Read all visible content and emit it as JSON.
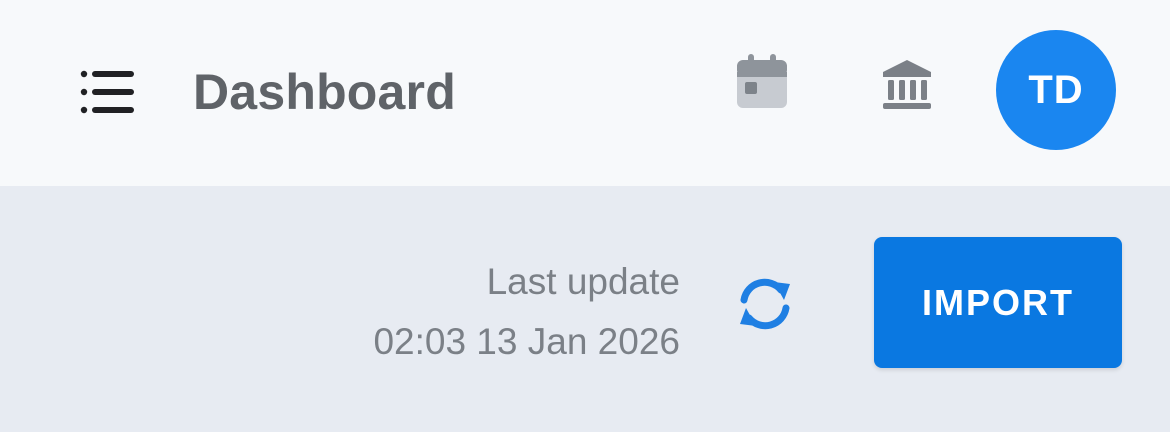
{
  "header": {
    "title": "Dashboard",
    "menu_icon": "menu-icon",
    "calendar_icon": "calendar-icon",
    "bank_icon": "bank-icon",
    "avatar_initials": "TD",
    "avatar_color": "#1a86f0"
  },
  "status": {
    "last_update_label": "Last update",
    "last_update_time": "02:03 13 Jan 2026",
    "refresh_icon": "refresh-icon"
  },
  "actions": {
    "import_label": "IMPORT",
    "import_color": "#0a78e1"
  }
}
